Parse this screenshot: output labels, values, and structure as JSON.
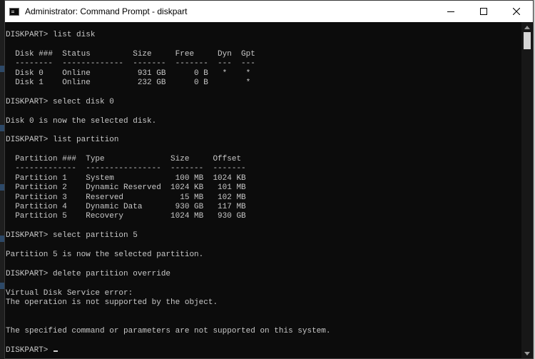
{
  "window": {
    "title": "Administrator: Command Prompt - diskpart",
    "controls": [
      "minimize",
      "maximize",
      "close"
    ]
  },
  "icons": {
    "app": "command-prompt-icon",
    "minimize": "minimize-icon",
    "maximize": "maximize-icon",
    "close": "close-icon",
    "scroll_up": "chevron-up-icon",
    "scroll_down": "chevron-down-icon"
  },
  "colors": {
    "terminal_bg": "#0c0c0c",
    "terminal_text": "#c8c8c8",
    "titlebar_bg": "#ffffff"
  },
  "terminal": {
    "lines": [
      "DISKPART> list disk",
      "",
      "  Disk ###  Status         Size     Free     Dyn  Gpt",
      "  --------  -------------  -------  -------  ---  ---",
      "  Disk 0    Online          931 GB      0 B   *    *",
      "  Disk 1    Online          232 GB      0 B        *",
      "",
      "DISKPART> select disk 0",
      "",
      "Disk 0 is now the selected disk.",
      "",
      "DISKPART> list partition",
      "",
      "  Partition ###  Type              Size     Offset",
      "  -------------  ----------------  -------  -------",
      "  Partition 1    System             100 MB  1024 KB",
      "  Partition 2    Dynamic Reserved  1024 KB   101 MB",
      "  Partition 3    Reserved            15 MB   102 MB",
      "  Partition 4    Dynamic Data       930 GB   117 MB",
      "  Partition 5    Recovery          1024 MB   930 GB",
      "",
      "DISKPART> select partition 5",
      "",
      "Partition 5 is now the selected partition.",
      "",
      "DISKPART> delete partition override",
      "",
      "Virtual Disk Service error:",
      "The operation is not supported by the object.",
      "",
      "",
      "The specified command or parameters are not supported on this system.",
      "",
      "DISKPART> "
    ]
  }
}
